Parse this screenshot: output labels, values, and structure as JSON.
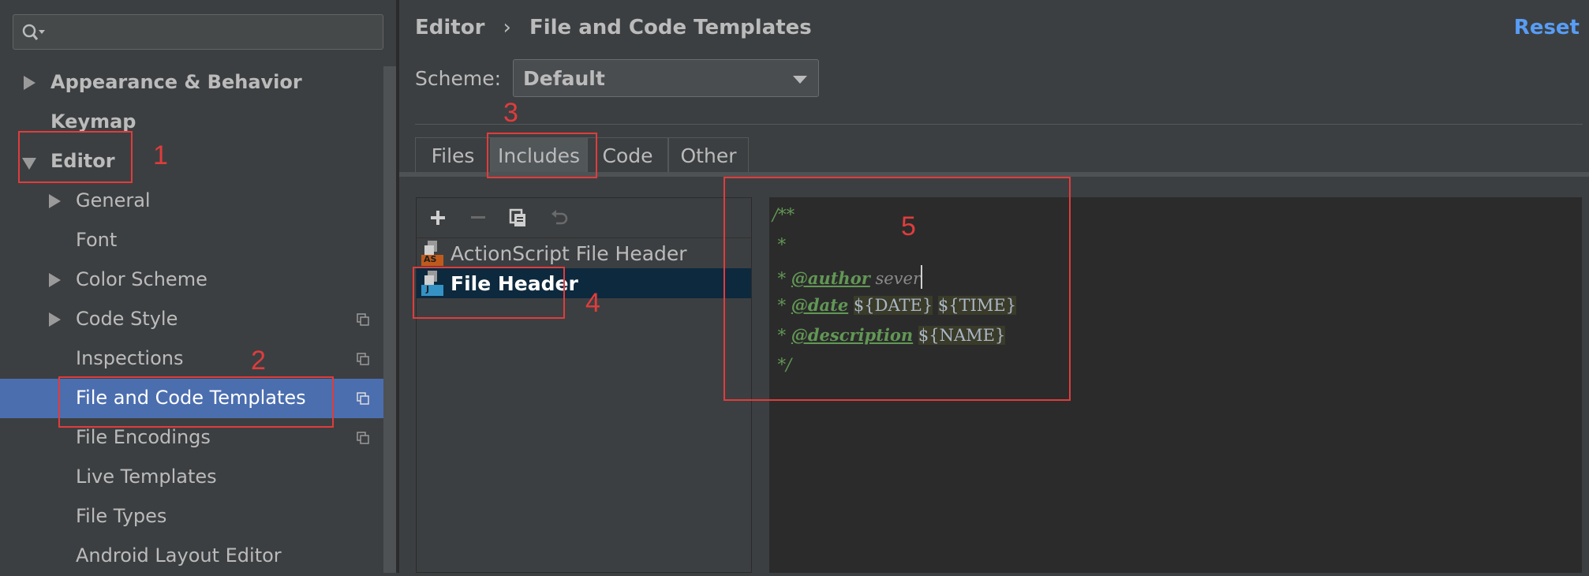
{
  "sidebar": {
    "search": {
      "placeholder": ""
    },
    "items": [
      {
        "label": "Appearance & Behavior"
      },
      {
        "label": "Keymap"
      },
      {
        "label": "Editor"
      },
      {
        "label": "General"
      },
      {
        "label": "Font"
      },
      {
        "label": "Color Scheme"
      },
      {
        "label": "Code Style"
      },
      {
        "label": "Inspections"
      },
      {
        "label": "File and Code Templates"
      },
      {
        "label": "File Encodings"
      },
      {
        "label": "Live Templates"
      },
      {
        "label": "File Types"
      },
      {
        "label": "Android Layout Editor"
      }
    ]
  },
  "header": {
    "breadcrumb_root": "Editor",
    "breadcrumb_separator": "›",
    "breadcrumb_current": "File and Code Templates",
    "reset_label": "Reset"
  },
  "scheme": {
    "label": "Scheme:",
    "value": "Default"
  },
  "tabs": [
    {
      "label": "Files"
    },
    {
      "label": "Includes"
    },
    {
      "label": "Code"
    },
    {
      "label": "Other"
    }
  ],
  "templates": [
    {
      "label": "ActionScript File Header",
      "badge": "AS"
    },
    {
      "label": "File Header",
      "badge": "J"
    }
  ],
  "editor": {
    "line1": "/**",
    "line2": " *",
    "line3_prefix": " * ",
    "line3_tag": "@author",
    "line3_text": " sever",
    "line4_prefix": " * ",
    "line4_tag": "@date",
    "line4_var1": "${DATE}",
    "line4_var2": "${TIME}",
    "line5_prefix": " * ",
    "line5_tag": "@description",
    "line5_var": "${NAME}",
    "line6": " */"
  },
  "annotations": [
    "1",
    "2",
    "3",
    "4",
    "5"
  ],
  "colors": {
    "selection": "#4b6eaf",
    "list_selection": "#0d293e",
    "annotation_red": "#e03c3c",
    "link_blue": "#589df6"
  }
}
